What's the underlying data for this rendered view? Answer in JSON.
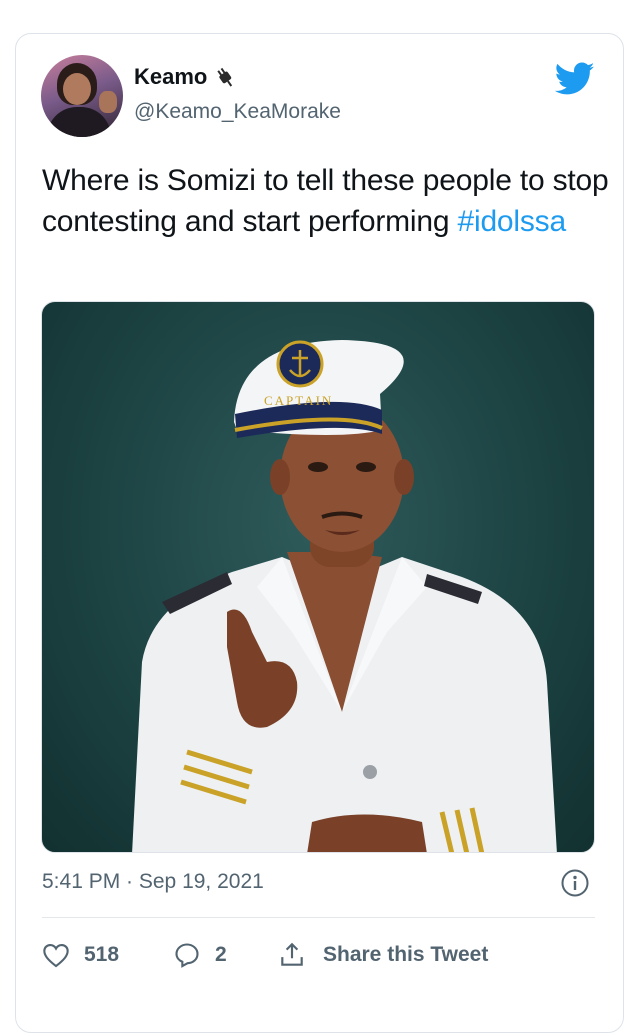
{
  "tweet": {
    "author": {
      "display_name": "Keamo",
      "handle": "@Keamo_KeaMorake",
      "name_emoji_icon": "electric-plug-icon"
    },
    "platform_icon": "twitter-bird-icon",
    "text_main": "Where is Somizi to tell these people to stop contesting and start performing ",
    "hashtag": "#idolssa",
    "media": {
      "description_icon": "photo",
      "hat_text": "CAPTAIN"
    },
    "timestamp": "5:41 PM · Sep 19, 2021",
    "info_icon": "info-icon",
    "actions": {
      "like_count": "518",
      "reply_count": "2",
      "share_label": "Share this Tweet"
    }
  },
  "colors": {
    "text_primary": "#0f1419",
    "text_secondary": "#536471",
    "accent": "#1d9bf0",
    "photo_background": "#1d4343"
  }
}
